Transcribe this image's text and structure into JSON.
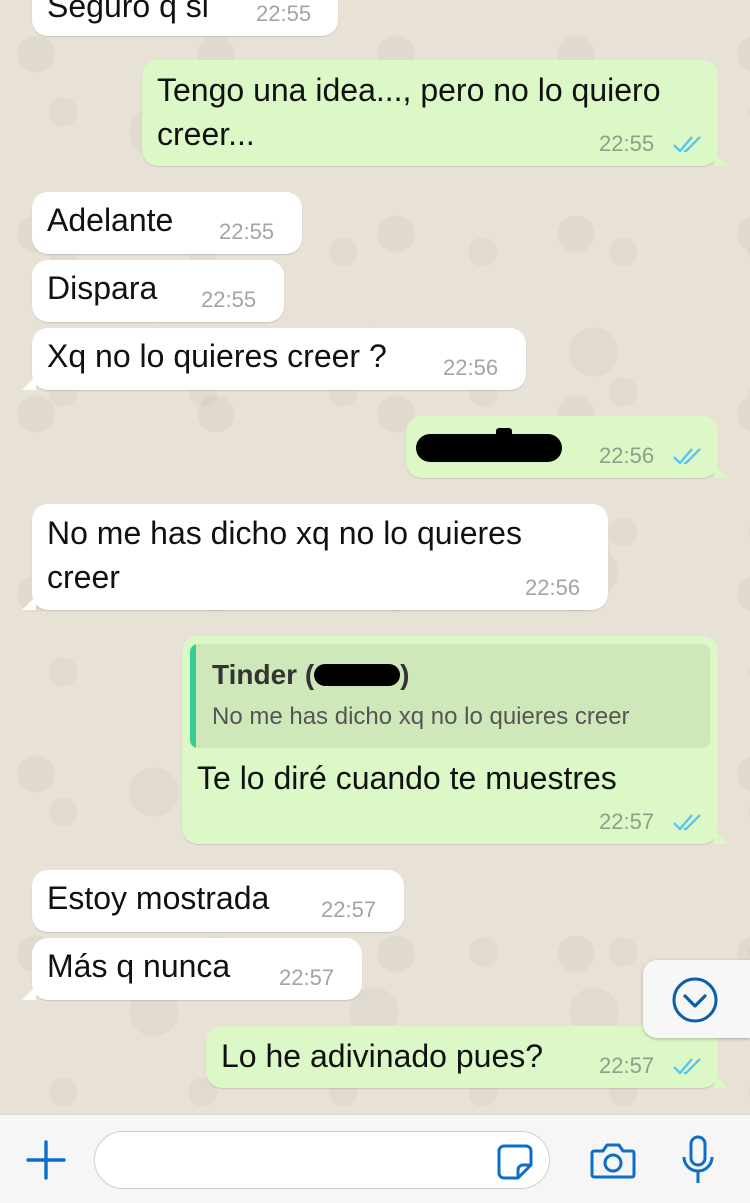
{
  "colors": {
    "incoming_bubble": "#ffffff",
    "outgoing_bubble": "#dcf8c6",
    "read_ticks": "#4fc3f7",
    "accent": "#0b6fc9"
  },
  "messages": [
    {
      "direction": "in",
      "text": "Seguro q si",
      "time": "22:55"
    },
    {
      "direction": "out",
      "lines": [
        "Tengo una idea..., pero no lo quiero",
        "creer..."
      ],
      "time": "22:55",
      "status": "read"
    },
    {
      "direction": "in",
      "text": "Adelante",
      "time": "22:55"
    },
    {
      "direction": "in",
      "text": "Dispara",
      "time": "22:55"
    },
    {
      "direction": "in",
      "text": "Xq no lo quieres creer ?",
      "time": "22:56"
    },
    {
      "direction": "out",
      "text": "",
      "redacted": true,
      "time": "22:56",
      "status": "read"
    },
    {
      "direction": "in",
      "lines": [
        "No me has dicho xq no lo quieres",
        "creer"
      ],
      "time": "22:56"
    },
    {
      "direction": "out",
      "reply_to": {
        "name": "Tinder (",
        "name_suffix": ")",
        "text": "No me has dicho xq no lo quieres creer"
      },
      "text": "Te lo diré cuando te muestres",
      "time": "22:57",
      "status": "read"
    },
    {
      "direction": "in",
      "text": "Estoy mostrada",
      "time": "22:57"
    },
    {
      "direction": "in",
      "text": "Más q nunca",
      "time": "22:57"
    },
    {
      "direction": "out",
      "text": "Lo he adivinado pues?",
      "time": "22:57",
      "status": "read"
    }
  ],
  "composer": {
    "attach_icon": "plus-icon",
    "sticker_icon": "sticker-icon",
    "camera_icon": "camera-icon",
    "mic_icon": "microphone-icon",
    "input_value": ""
  },
  "scroll_down_icon": "chevron-down-circle-icon"
}
